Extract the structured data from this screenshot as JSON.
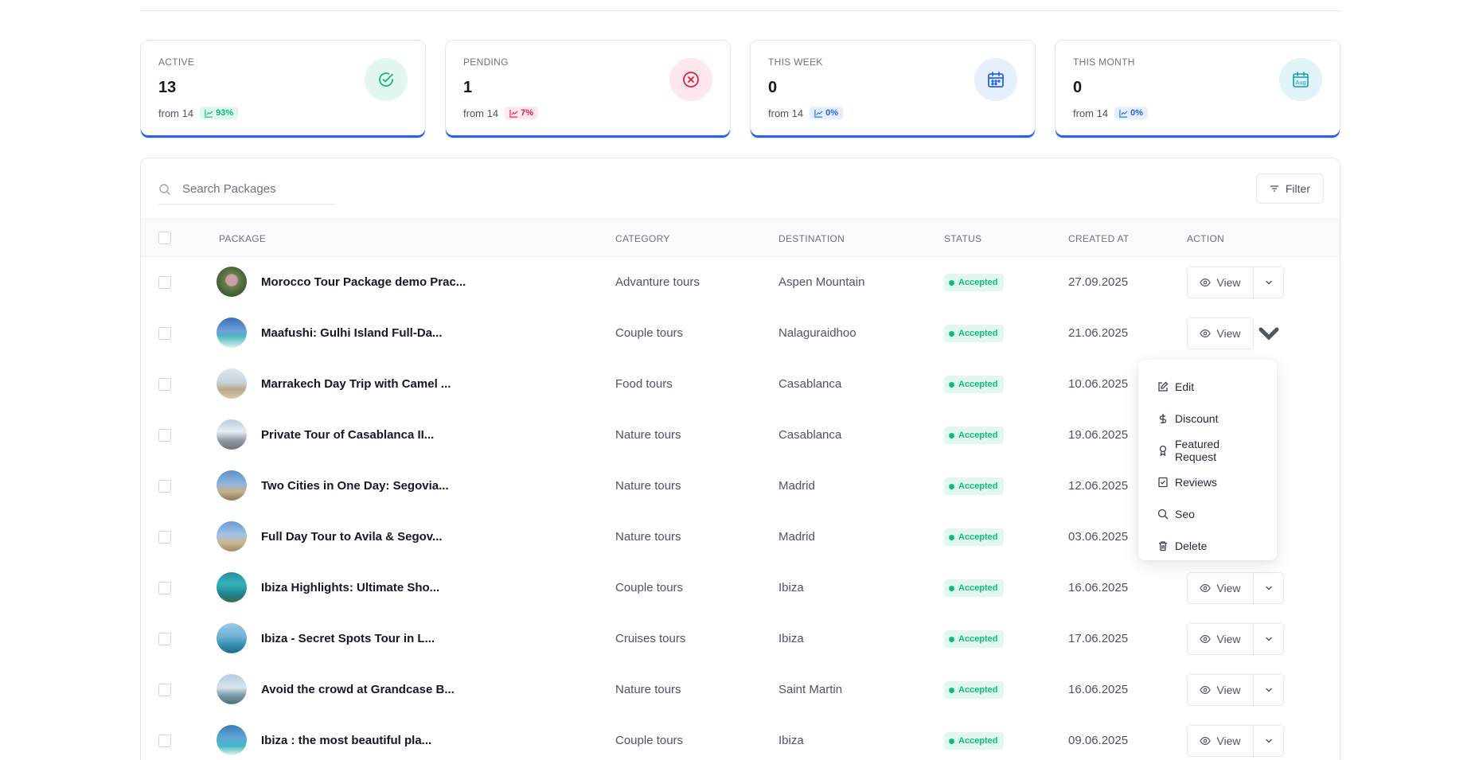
{
  "stats": [
    {
      "label": "ACTIVE",
      "value": "13",
      "from": "from 14",
      "trend": "93%",
      "color": "#10b981",
      "icon": "check-circle-icon"
    },
    {
      "label": "PENDING",
      "value": "1",
      "from": "from 14",
      "trend": "7%",
      "color": "#e11d48",
      "icon": "x-circle-icon"
    },
    {
      "label": "THIS WEEK",
      "value": "0",
      "from": "from 14",
      "trend": "0%",
      "color": "#2563eb",
      "icon": "calendar-week-icon"
    },
    {
      "label": "THIS MONTH",
      "value": "0",
      "from": "from 14",
      "trend": "0%",
      "color": "#0e9fb0",
      "icon": "calendar-month-icon",
      "icon_text": "Aug"
    }
  ],
  "search": {
    "placeholder": "Search Packages"
  },
  "filter_label": "Filter",
  "columns": {
    "package": "PACKAGE",
    "category": "CATEGORY",
    "destination": "DESTINATION",
    "status": "STATUS",
    "created_at": "CREATED AT",
    "action": "ACTION"
  },
  "view_label": "View",
  "rows": [
    {
      "name": "Morocco Tour Package demo Prac...",
      "category": "Advanture tours",
      "destination": "Aspen Mountain",
      "status": "Accepted",
      "created": "27.09.2025"
    },
    {
      "name": "Maafushi: Gulhi Island Full-Da...",
      "category": "Couple tours",
      "destination": "Nalaguraidhoo",
      "status": "Accepted",
      "created": "21.06.2025"
    },
    {
      "name": "Marrakech Day Trip with Camel ...",
      "category": "Food tours",
      "destination": "Casablanca",
      "status": "Accepted",
      "created": "10.06.2025"
    },
    {
      "name": "Private Tour of Casablanca II...",
      "category": "Nature tours",
      "destination": "Casablanca",
      "status": "Accepted",
      "created": "19.06.2025"
    },
    {
      "name": "Two Cities in One Day: Segovia...",
      "category": "Nature tours",
      "destination": "Madrid",
      "status": "Accepted",
      "created": "12.06.2025"
    },
    {
      "name": "Full Day Tour to Avila & Segov...",
      "category": "Nature tours",
      "destination": "Madrid",
      "status": "Accepted",
      "created": "03.06.2025"
    },
    {
      "name": "Ibiza Highlights: Ultimate Sho...",
      "category": "Couple tours",
      "destination": "Ibiza",
      "status": "Accepted",
      "created": "16.06.2025"
    },
    {
      "name": "Ibiza - Secret Spots Tour in L...",
      "category": "Cruises tours",
      "destination": "Ibiza",
      "status": "Accepted",
      "created": "17.06.2025"
    },
    {
      "name": "Avoid the crowd at Grandcase B...",
      "category": "Nature tours",
      "destination": "Saint Martin",
      "status": "Accepted",
      "created": "16.06.2025"
    },
    {
      "name": "Ibiza : the most beautiful pla...",
      "category": "Couple tours",
      "destination": "Ibiza",
      "status": "Accepted",
      "created": "09.06.2025"
    }
  ],
  "dropdown": [
    {
      "label": "Edit",
      "icon": "edit-icon"
    },
    {
      "label": "Discount",
      "icon": "dollar-icon"
    },
    {
      "label": "Featured Request",
      "icon": "award-icon"
    },
    {
      "label": "Reviews",
      "icon": "reviews-icon"
    },
    {
      "label": "Seo",
      "icon": "search-icon"
    },
    {
      "label": "Delete",
      "icon": "trash-icon"
    }
  ]
}
